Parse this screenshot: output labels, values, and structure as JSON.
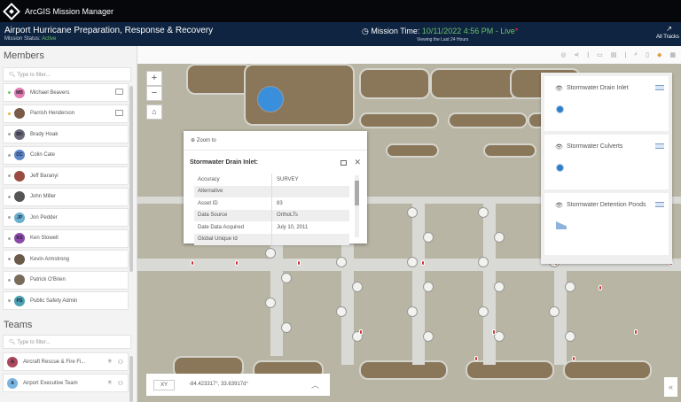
{
  "app": {
    "title": "ArcGIS Mission Manager"
  },
  "mission": {
    "title": "Airport Hurricane Preparation, Response & Recovery",
    "status_label": "Mission Status:",
    "status": "Active",
    "time_label": "Mission Time:",
    "time": "10/11/2022 4:56 PM - Live",
    "live_marker": "*",
    "viewing": "Viewing the Last 24 Hours",
    "all_tracks": "All Tracks"
  },
  "members": {
    "title": "Members",
    "placeholder": "Type to filter...",
    "items": [
      {
        "initials": "MB",
        "name": "Michael Beavers",
        "color": "#e27bb0",
        "status": "#7cc66a",
        "device": true
      },
      {
        "initials": "",
        "name": "Parrish Henderson",
        "color": "#7a5a48",
        "status": "#e8b43a",
        "device": true
      },
      {
        "initials": "BH",
        "name": "Brady Hoak",
        "color": "#6a6a7a",
        "status": "#aaa",
        "device": false
      },
      {
        "initials": "CC",
        "name": "Colin Cate",
        "color": "#5b86c8",
        "status": "#aaa",
        "device": false
      },
      {
        "initials": "",
        "name": "Jeff Baranyi",
        "color": "#9a4a40",
        "status": "#aaa",
        "device": false
      },
      {
        "initials": "",
        "name": "John Miller",
        "color": "#555",
        "status": "#aaa",
        "device": false
      },
      {
        "initials": "JP",
        "name": "Jon Pedder",
        "color": "#6aaed0",
        "status": "#aaa",
        "device": false
      },
      {
        "initials": "KS",
        "name": "Ken Stowell",
        "color": "#8a4aa8",
        "status": "#aaa",
        "device": false
      },
      {
        "initials": "",
        "name": "Kevin Armstrong",
        "color": "#6a5a4a",
        "status": "#aaa",
        "device": false
      },
      {
        "initials": "",
        "name": "Patrick O'Brien",
        "color": "#7a6a5a",
        "status": "#aaa",
        "device": false
      },
      {
        "initials": "PS",
        "name": "Public Safety Admin",
        "color": "#4aa0b0",
        "status": "#aaa",
        "device": false
      }
    ]
  },
  "teams": {
    "title": "Teams",
    "placeholder": "Type to filter...",
    "items": [
      {
        "initials": "A",
        "name": "Aircraft Rescue & Fire Fi...",
        "color": "#a8485a"
      },
      {
        "initials": "A",
        "name": "Airport Executive Team",
        "color": "#7ab4e0"
      }
    ]
  },
  "popup": {
    "zoom_to": "Zoom to",
    "title": "Stormwater Drain Inlet:",
    "rows": [
      {
        "k": "Accuracy",
        "v": "SURVEY"
      },
      {
        "k": "Alternative",
        "v": ""
      },
      {
        "k": "Asset ID",
        "v": "83"
      },
      {
        "k": "Data Source",
        "v": "OrthoLTs"
      },
      {
        "k": "Date Data Acquired",
        "v": "July 10, 2011"
      },
      {
        "k": "Global Unique Id",
        "v": ""
      }
    ]
  },
  "legend": {
    "layers": [
      "Stormwater Drain Inlet",
      "Stormwater Culverts",
      "Stormwater Detention Ponds"
    ]
  },
  "coords": {
    "mode": "XY",
    "value": "-84.423317°, 33.63917d°"
  }
}
